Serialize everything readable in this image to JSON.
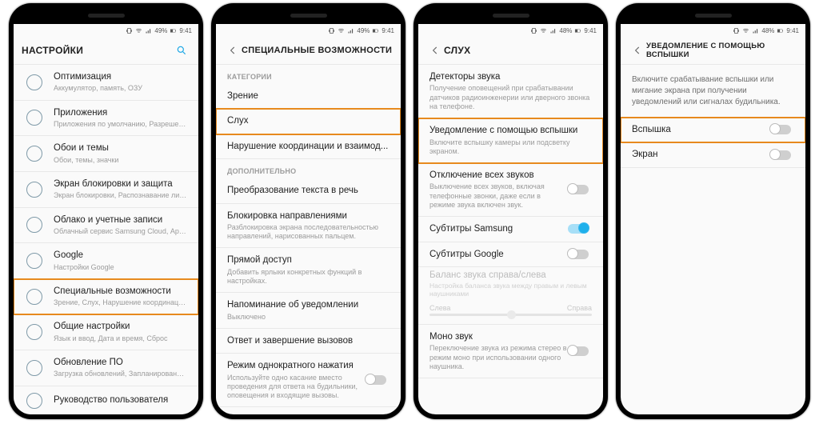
{
  "status": {
    "battery": "49%",
    "battery2": "48%",
    "time": "9:41"
  },
  "p1": {
    "title": "НАСТРОЙКИ",
    "items": [
      {
        "t": "Оптимизация",
        "s": "Аккумулятор, память, ОЗУ"
      },
      {
        "t": "Приложения",
        "s": "Приложения по умолчанию, Разрешения..."
      },
      {
        "t": "Обои и темы",
        "s": "Обои, темы, значки"
      },
      {
        "t": "Экран блокировки и защита",
        "s": "Экран блокировки, Распознавание лица..."
      },
      {
        "t": "Облако и учетные записи",
        "s": "Облачный сервис Samsung Cloud, Архив..."
      },
      {
        "t": "Google",
        "s": "Настройки Google"
      },
      {
        "t": "Специальные возможности",
        "s": "Зрение, Слух, Нарушение координации и..."
      },
      {
        "t": "Общие настройки",
        "s": "Язык и ввод, Дата и время, Сброс"
      },
      {
        "t": "Обновление ПО",
        "s": "Загрузка обновлений, Запланированное..."
      },
      {
        "t": "Руководство пользователя",
        "s": ""
      }
    ]
  },
  "p2": {
    "title": "СПЕЦИАЛЬНЫЕ ВОЗМОЖНОСТИ",
    "cat1": "КАТЕГОРИИ",
    "items1": [
      {
        "t": "Зрение"
      },
      {
        "t": "Слух"
      },
      {
        "t": "Нарушение координации и взаимод..."
      }
    ],
    "cat2": "ДОПОЛНИТЕЛЬНО",
    "items2": [
      {
        "t": "Преобразование текста в речь"
      },
      {
        "t": "Блокировка направлениями",
        "s": "Разблокировка экрана последовательностью направлений, нарисованных пальцем."
      },
      {
        "t": "Прямой доступ",
        "s": "Добавить ярлыки конкретных функций в настройках."
      },
      {
        "t": "Напоминание об уведомлении",
        "s": "Выключено"
      },
      {
        "t": "Ответ и завершение вызовов"
      },
      {
        "t": "Режим однократного нажатия",
        "s": "Используйте одно касание вместо проведения для ответа на будильники, оповещения и входящие вызовы."
      }
    ]
  },
  "p3": {
    "title": "СЛУХ",
    "items": [
      {
        "t": "Детекторы звука",
        "s": "Получение оповещений при срабатывании датчиков радиоинженерии или дверного звонка на телефоне."
      },
      {
        "t": "Уведомление с помощью вспышки",
        "s": "Включите вспышку камеры или подсветку экраном."
      },
      {
        "t": "Отключение всех звуков",
        "s": "Выключение всех звуков, включая телефонные звонки, даже если в режиме звука включен звук.",
        "tog": "off"
      },
      {
        "t": "Субтитры Samsung",
        "tog": "on"
      },
      {
        "t": "Субтитры Google",
        "tog": "off"
      }
    ],
    "slider": {
      "title": "Баланс звука справа/слева",
      "sub": "Настройка баланса звука между правым и левым наушниками",
      "l": "Слева",
      "r": "Справа"
    },
    "mono": {
      "t": "Моно звук",
      "s": "Переключение звука из режима стерео в режим моно при использовании одного наушника.",
      "tog": "off"
    }
  },
  "p4": {
    "title": "УВЕДОМЛЕНИЕ С ПОМОЩЬЮ ВСПЫШКИ",
    "desc": "Включите срабатывание вспышки или мигание экрана при получении уведомлений или сигналах будильника.",
    "items": [
      {
        "t": "Вспышка",
        "tog": "off"
      },
      {
        "t": "Экран",
        "tog": "off"
      }
    ]
  }
}
